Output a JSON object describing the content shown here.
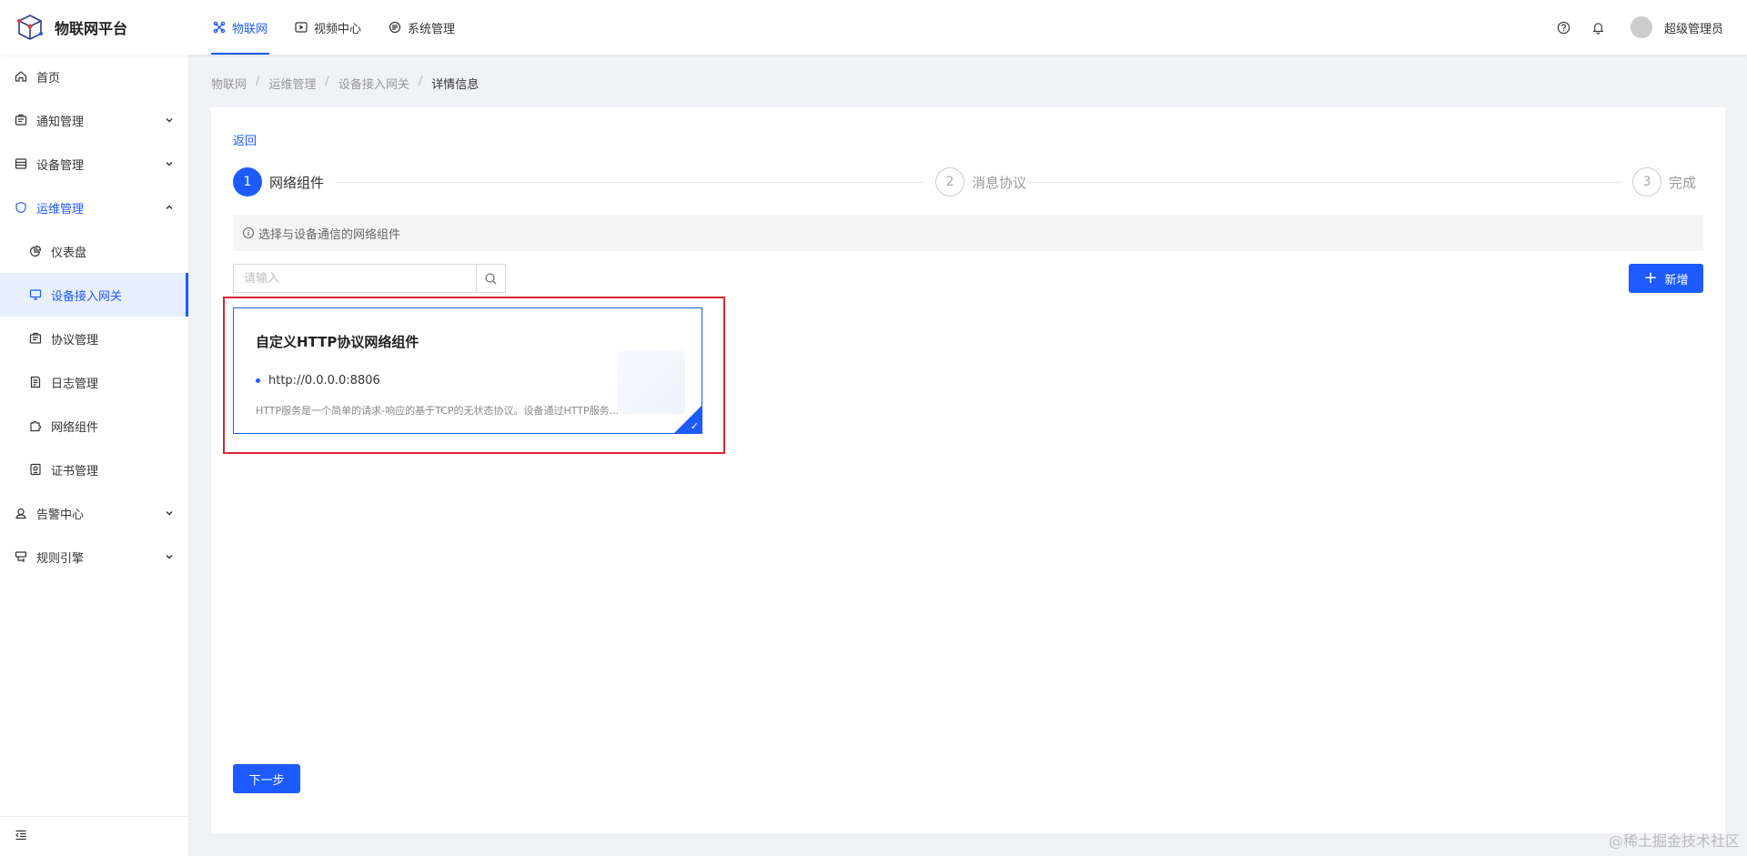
{
  "app": {
    "title": "物联网平台"
  },
  "topnav": [
    {
      "label": "物联网",
      "icon": "iot-icon",
      "active": true
    },
    {
      "label": "视频中心",
      "icon": "video-play-icon",
      "active": false
    },
    {
      "label": "系统管理",
      "icon": "system-icon",
      "active": false
    }
  ],
  "header": {
    "username": "超级管理员"
  },
  "sidebar": {
    "items": [
      {
        "label": "首页"
      },
      {
        "label": "通知管理"
      },
      {
        "label": "设备管理"
      },
      {
        "label": "运维管理"
      },
      {
        "label": "仪表盘"
      },
      {
        "label": "设备接入网关"
      },
      {
        "label": "协议管理"
      },
      {
        "label": "日志管理"
      },
      {
        "label": "网络组件"
      },
      {
        "label": "证书管理"
      },
      {
        "label": "告警中心"
      },
      {
        "label": "规则引擎"
      }
    ]
  },
  "breadcrumb": [
    "物联网",
    "运维管理",
    "设备接入网关",
    "详情信息"
  ],
  "main": {
    "back_label": "返回",
    "steps": [
      {
        "num": "1",
        "title": "网络组件"
      },
      {
        "num": "2",
        "title": "消息协议"
      },
      {
        "num": "3",
        "title": "完成"
      }
    ],
    "info_text": "选择与设备通信的网络组件",
    "search_placeholder": "请输入",
    "add_label": "新增",
    "component": {
      "title": "自定义HTTP协议网络组件",
      "address": "http://0.0.0.0:8806",
      "description": "HTTP服务是一个简单的请求-响应的基于TCP的无状态协议。设备通过HTTP服务..."
    },
    "next_label": "下一步"
  },
  "watermark": "@稀土掘金技术社区",
  "colors": {
    "primary": "#1d5bff",
    "highlight": "#d92630"
  }
}
